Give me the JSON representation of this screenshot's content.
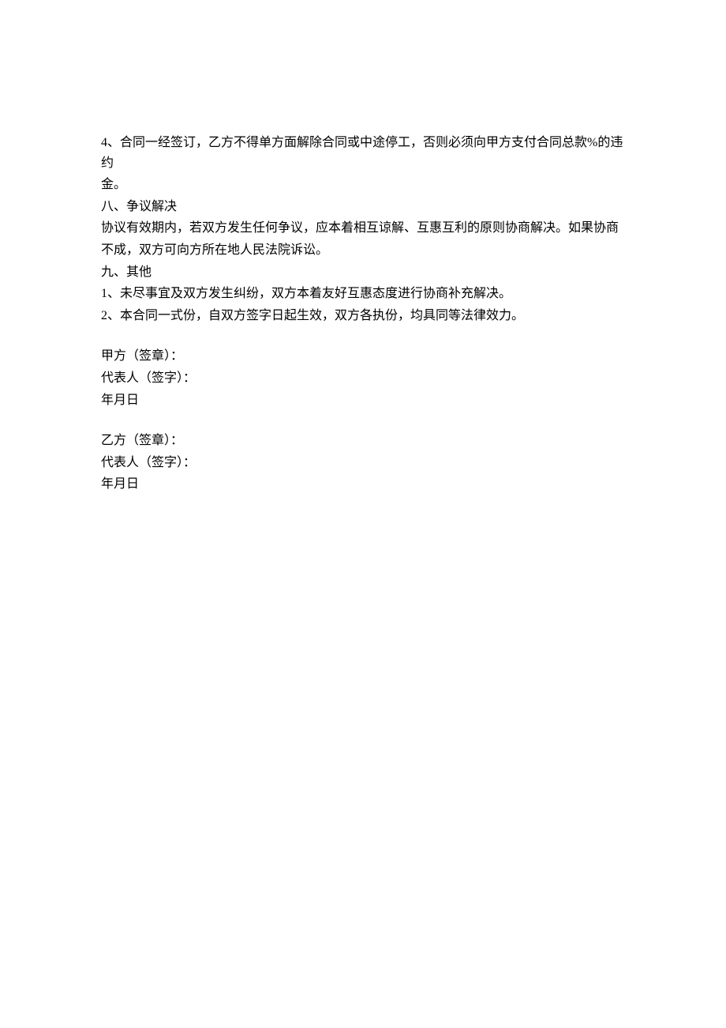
{
  "lines": [
    "4、合同一经签订，乙方不得单方面解除合同或中途停工，否则必须向甲方支付合同总款%的违约",
    "金。",
    "八、争议解决",
    "协议有效期内，若双方发生任何争议，应本着相互谅解、互惠互利的原则协商解决。如果协商",
    "不成，双方可向方所在地人民法院诉讼。",
    "九、其他",
    "1、未尽事宜及双方发生纠纷，双方本着友好互惠态度进行协商补充解决。",
    "2、本合同一式份，自双方签字日起生效，双方各执份，均具同等法律效力。",
    "",
    "甲方（签章）：",
    "代表人（签字）：",
    "年月日",
    "",
    "乙方（签章）：",
    "代表人（签字）：",
    "        年月日"
  ]
}
